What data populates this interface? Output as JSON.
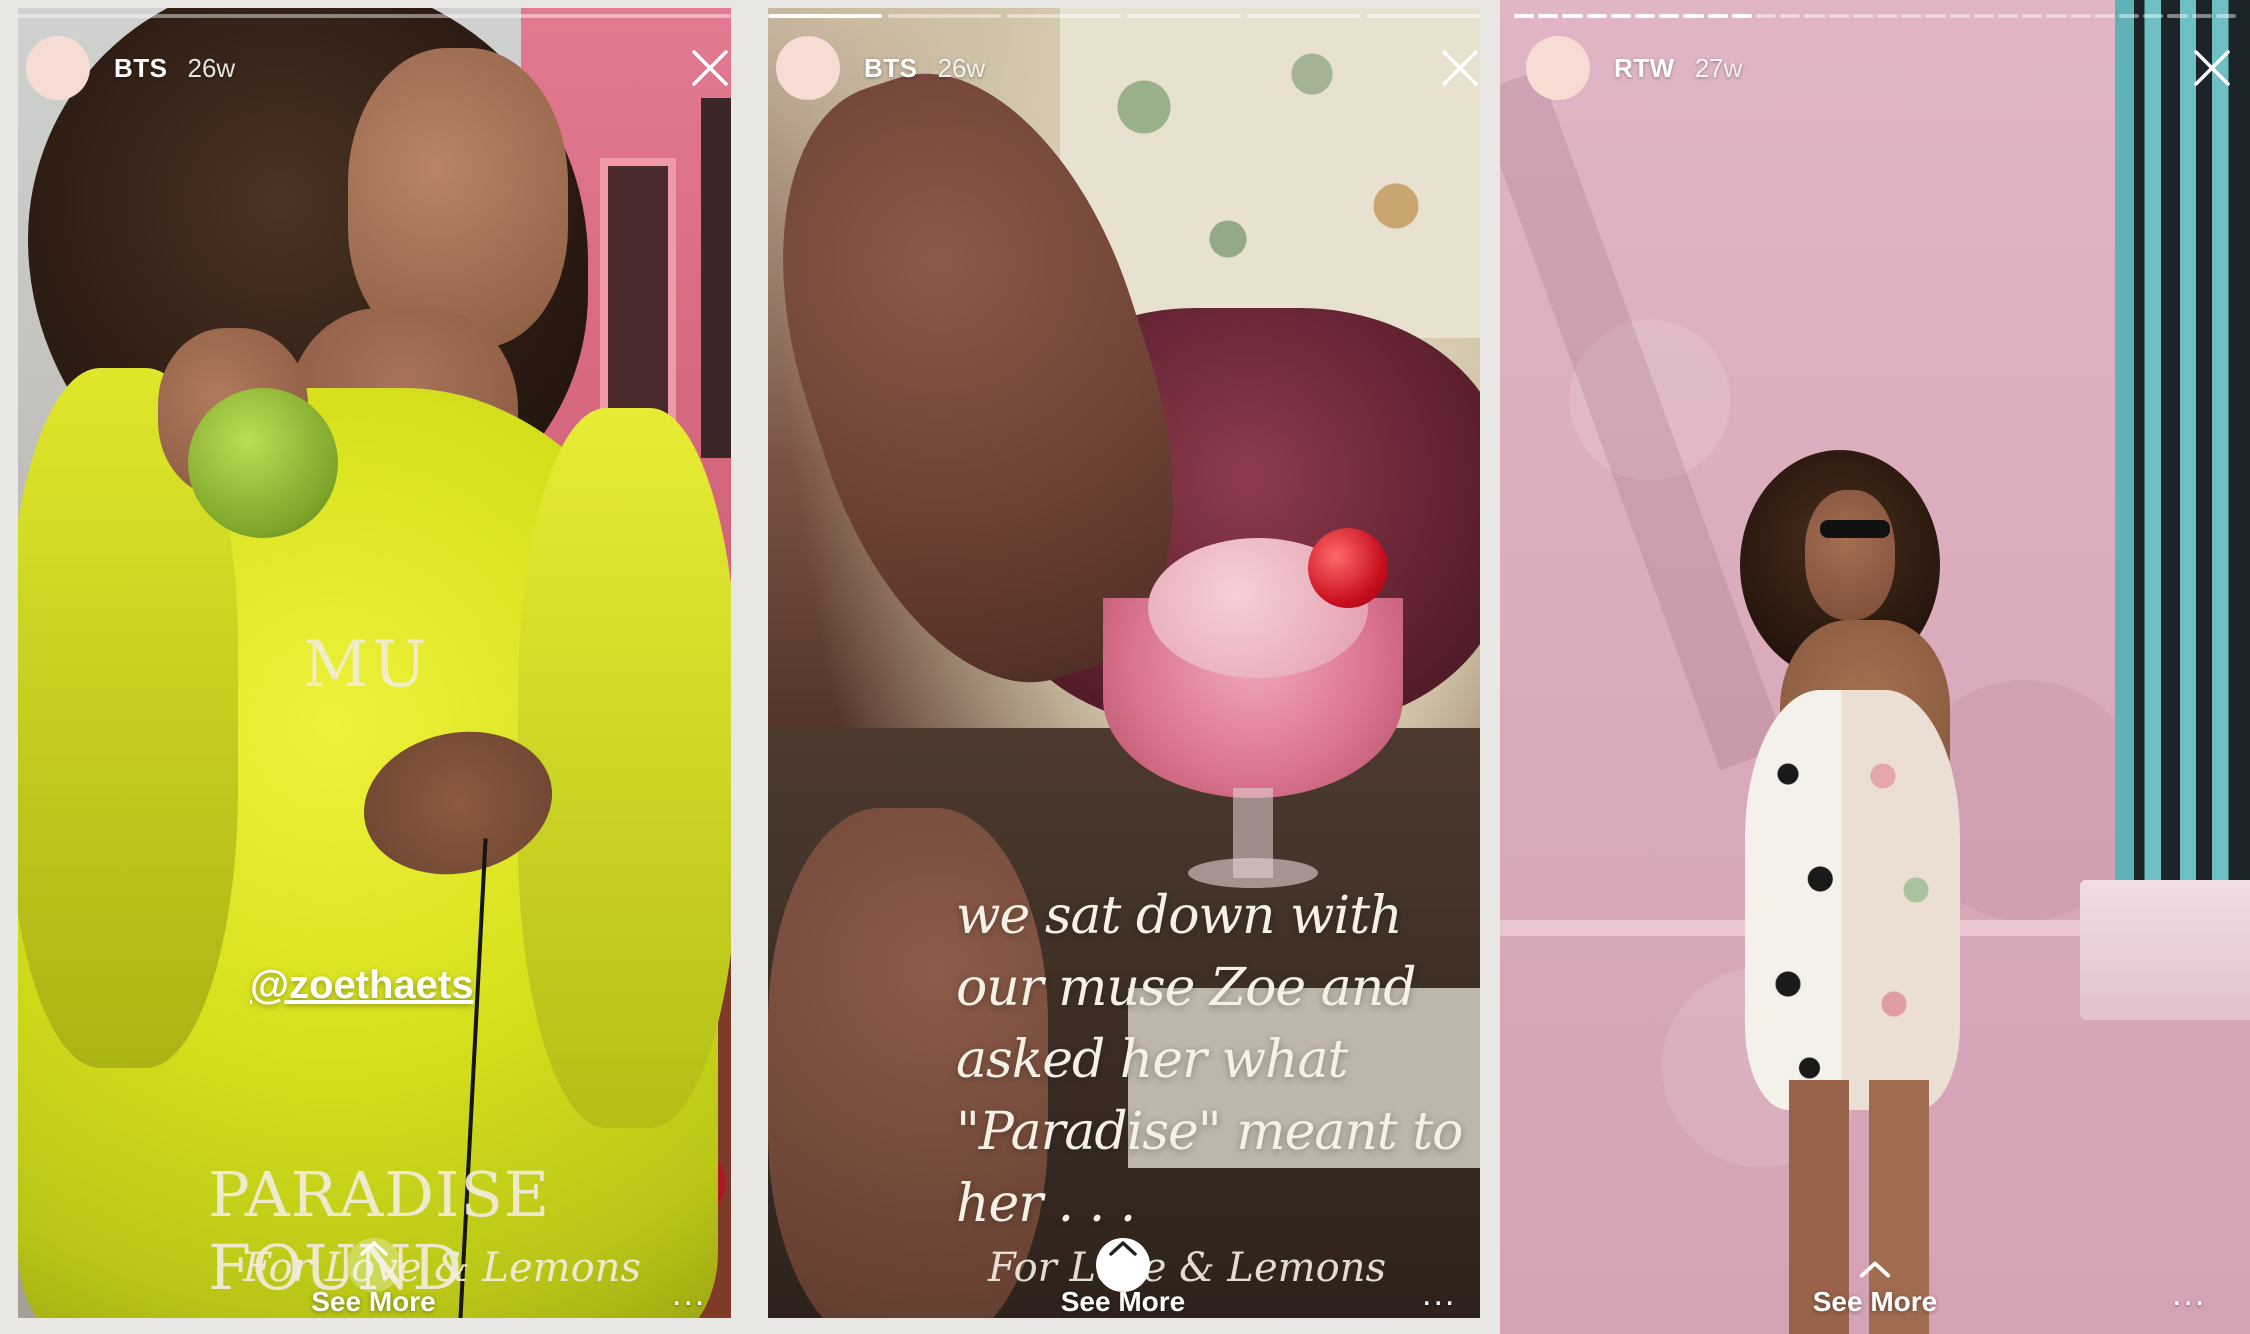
{
  "stories": [
    {
      "username": "BTS",
      "time": "26w",
      "progress_total": 1,
      "progress_done": 0,
      "overlay": {
        "title_text": "MU",
        "mention": "@zoethaets",
        "graphic_text": "PARADISE FOUND",
        "signature": "For Love & Lemons"
      },
      "see_more_label": "See More",
      "more_label": "..."
    },
    {
      "username": "BTS",
      "time": "26w",
      "progress_total": 6,
      "progress_done": 1,
      "overlay": {
        "caption": "we sat down with our muse Zoe and asked her what \"Paradise\" meant to her . . .",
        "signature": "For Love & Lemons"
      },
      "see_more_label": "See More",
      "more_label": "..."
    },
    {
      "username": "RTW",
      "time": "27w",
      "progress_total": 30,
      "progress_done": 10,
      "see_more_label": "See More",
      "more_label": "..."
    }
  ],
  "icons": {
    "close": "close-icon",
    "chevron": "chevron-up-icon",
    "more": "more-dots-icon"
  },
  "colors": {
    "avatar": "#f6dcd2",
    "text": "#ffffff"
  }
}
